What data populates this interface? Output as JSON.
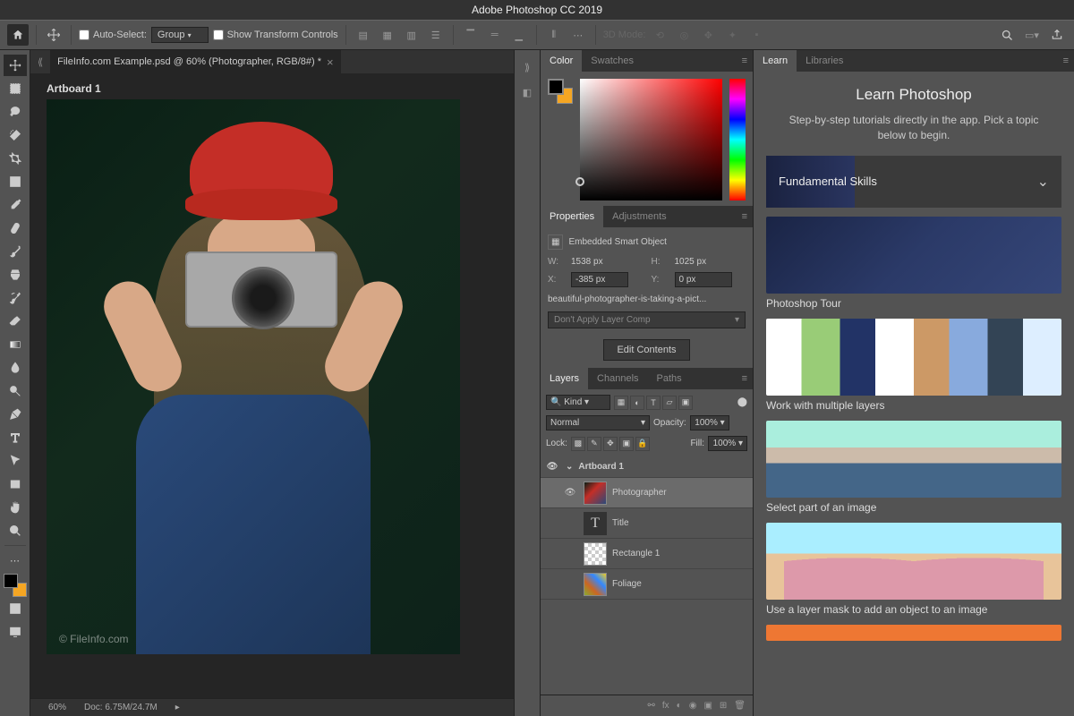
{
  "app_title": "Adobe Photoshop CC 2019",
  "optionsbar": {
    "auto_select_label": "Auto-Select:",
    "auto_select_value": "Group",
    "show_transform_label": "Show Transform Controls",
    "mode_3d_label": "3D Mode:"
  },
  "document": {
    "tab_title": "FileInfo.com Example.psd @ 60% (Photographer, RGB/8#) *",
    "artboard_label": "Artboard 1",
    "watermark": "© FileInfo.com",
    "zoom": "60%",
    "doc_size": "Doc: 6.75M/24.7M"
  },
  "panels": {
    "color_tab": "Color",
    "swatches_tab": "Swatches",
    "properties_tab": "Properties",
    "adjustments_tab": "Adjustments",
    "layers_tab": "Layers",
    "channels_tab": "Channels",
    "paths_tab": "Paths",
    "learn_tab": "Learn",
    "libraries_tab": "Libraries"
  },
  "properties": {
    "type_label": "Embedded Smart Object",
    "w_label": "W:",
    "w_value": "1538 px",
    "h_label": "H:",
    "h_value": "1025 px",
    "x_label": "X:",
    "x_value": "-385 px",
    "y_label": "Y:",
    "y_value": "0 px",
    "filename": "beautiful-photographer-is-taking-a-pict...",
    "layer_comp": "Don't Apply Layer Comp",
    "edit_btn": "Edit Contents"
  },
  "layers": {
    "kind_label": "Kind",
    "blend_mode": "Normal",
    "opacity_label": "Opacity:",
    "opacity_value": "100%",
    "lock_label": "Lock:",
    "fill_label": "Fill:",
    "fill_value": "100%",
    "items": [
      {
        "name": "Artboard 1",
        "type": "artboard"
      },
      {
        "name": "Photographer",
        "type": "smart",
        "selected": true,
        "visible": true
      },
      {
        "name": "Title",
        "type": "text"
      },
      {
        "name": "Rectangle 1",
        "type": "shape"
      },
      {
        "name": "Foliage",
        "type": "image"
      }
    ]
  },
  "learn": {
    "title": "Learn Photoshop",
    "subtitle": "Step-by-step tutorials directly in the app. Pick a topic below to begin.",
    "hero": "Fundamental Skills",
    "cards": [
      "Photoshop Tour",
      "Work with multiple layers",
      "Select part of an image",
      "Use a layer mask to add an object to an image"
    ]
  },
  "colors": {
    "fg": "#000000",
    "bg": "#f5a623"
  }
}
